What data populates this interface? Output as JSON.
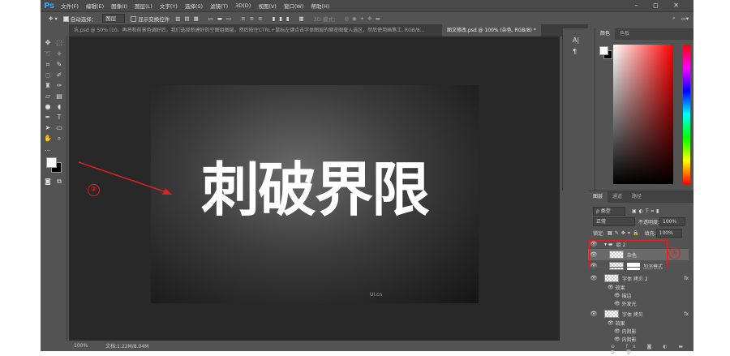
{
  "app": {
    "logo": "Ps",
    "window_controls": "– ◻ ✕"
  },
  "menu": [
    "文件(F)",
    "编辑(E)",
    "图像(I)",
    "图层(L)",
    "文字(Y)",
    "选择(S)",
    "滤镜(T)",
    "3D(D)",
    "视图(V)",
    "窗口(W)",
    "帮助(H)"
  ],
  "options": {
    "auto_select_label": "自动选择：",
    "auto_select_value": "图层",
    "show_transform_label": "显示变换控件",
    "mode_3d": "3D 模式："
  },
  "tabs": [
    {
      "label": "坑.psd @ 50% (10、再将和前景色调好后，我们选择新建好的空图组图层，然后按住CTRL+鼠标左键点击字体图层的缩览图载入选区，然后使用画笔工, RGB/8...",
      "active": false
    },
    {
      "label": "图文修改.psd @ 100% (杂色, RGB/8) *",
      "active": true
    }
  ],
  "canvas": {
    "headline": "刺破界限",
    "watermark": "UI.cn"
  },
  "status": {
    "zoom": "100%",
    "doc": "文档:1.22M/8.04M"
  },
  "color_panel": {
    "tabs": [
      "颜色",
      "色板"
    ]
  },
  "layers_panel": {
    "tabs": [
      "图层",
      "通道",
      "路径"
    ],
    "filter": "ρ 类型",
    "blend": "正常",
    "opacity_label": "不透明度:",
    "opacity": "100%",
    "lock_label": "锁定:",
    "fill_label": "填充:",
    "fill": "100%",
    "layers": [
      {
        "name": "组 2",
        "type": "group"
      },
      {
        "name": "杂色",
        "selected": true
      },
      {
        "name": "加深模式"
      },
      {
        "name": "字体 拷贝 2",
        "fx": "fx"
      },
      {
        "name": "效果",
        "sub": 1
      },
      {
        "name": "描边",
        "sub": 2
      },
      {
        "name": "外发光",
        "sub": 2
      },
      {
        "name": "字体 拷贝",
        "fx": "fx"
      },
      {
        "name": "效果",
        "sub": 1
      },
      {
        "name": "内阴影",
        "sub": 2
      },
      {
        "name": "内阴影",
        "sub": 2
      }
    ]
  },
  "annotations": {
    "one": "①",
    "two": "②",
    "color": "#e02020"
  }
}
